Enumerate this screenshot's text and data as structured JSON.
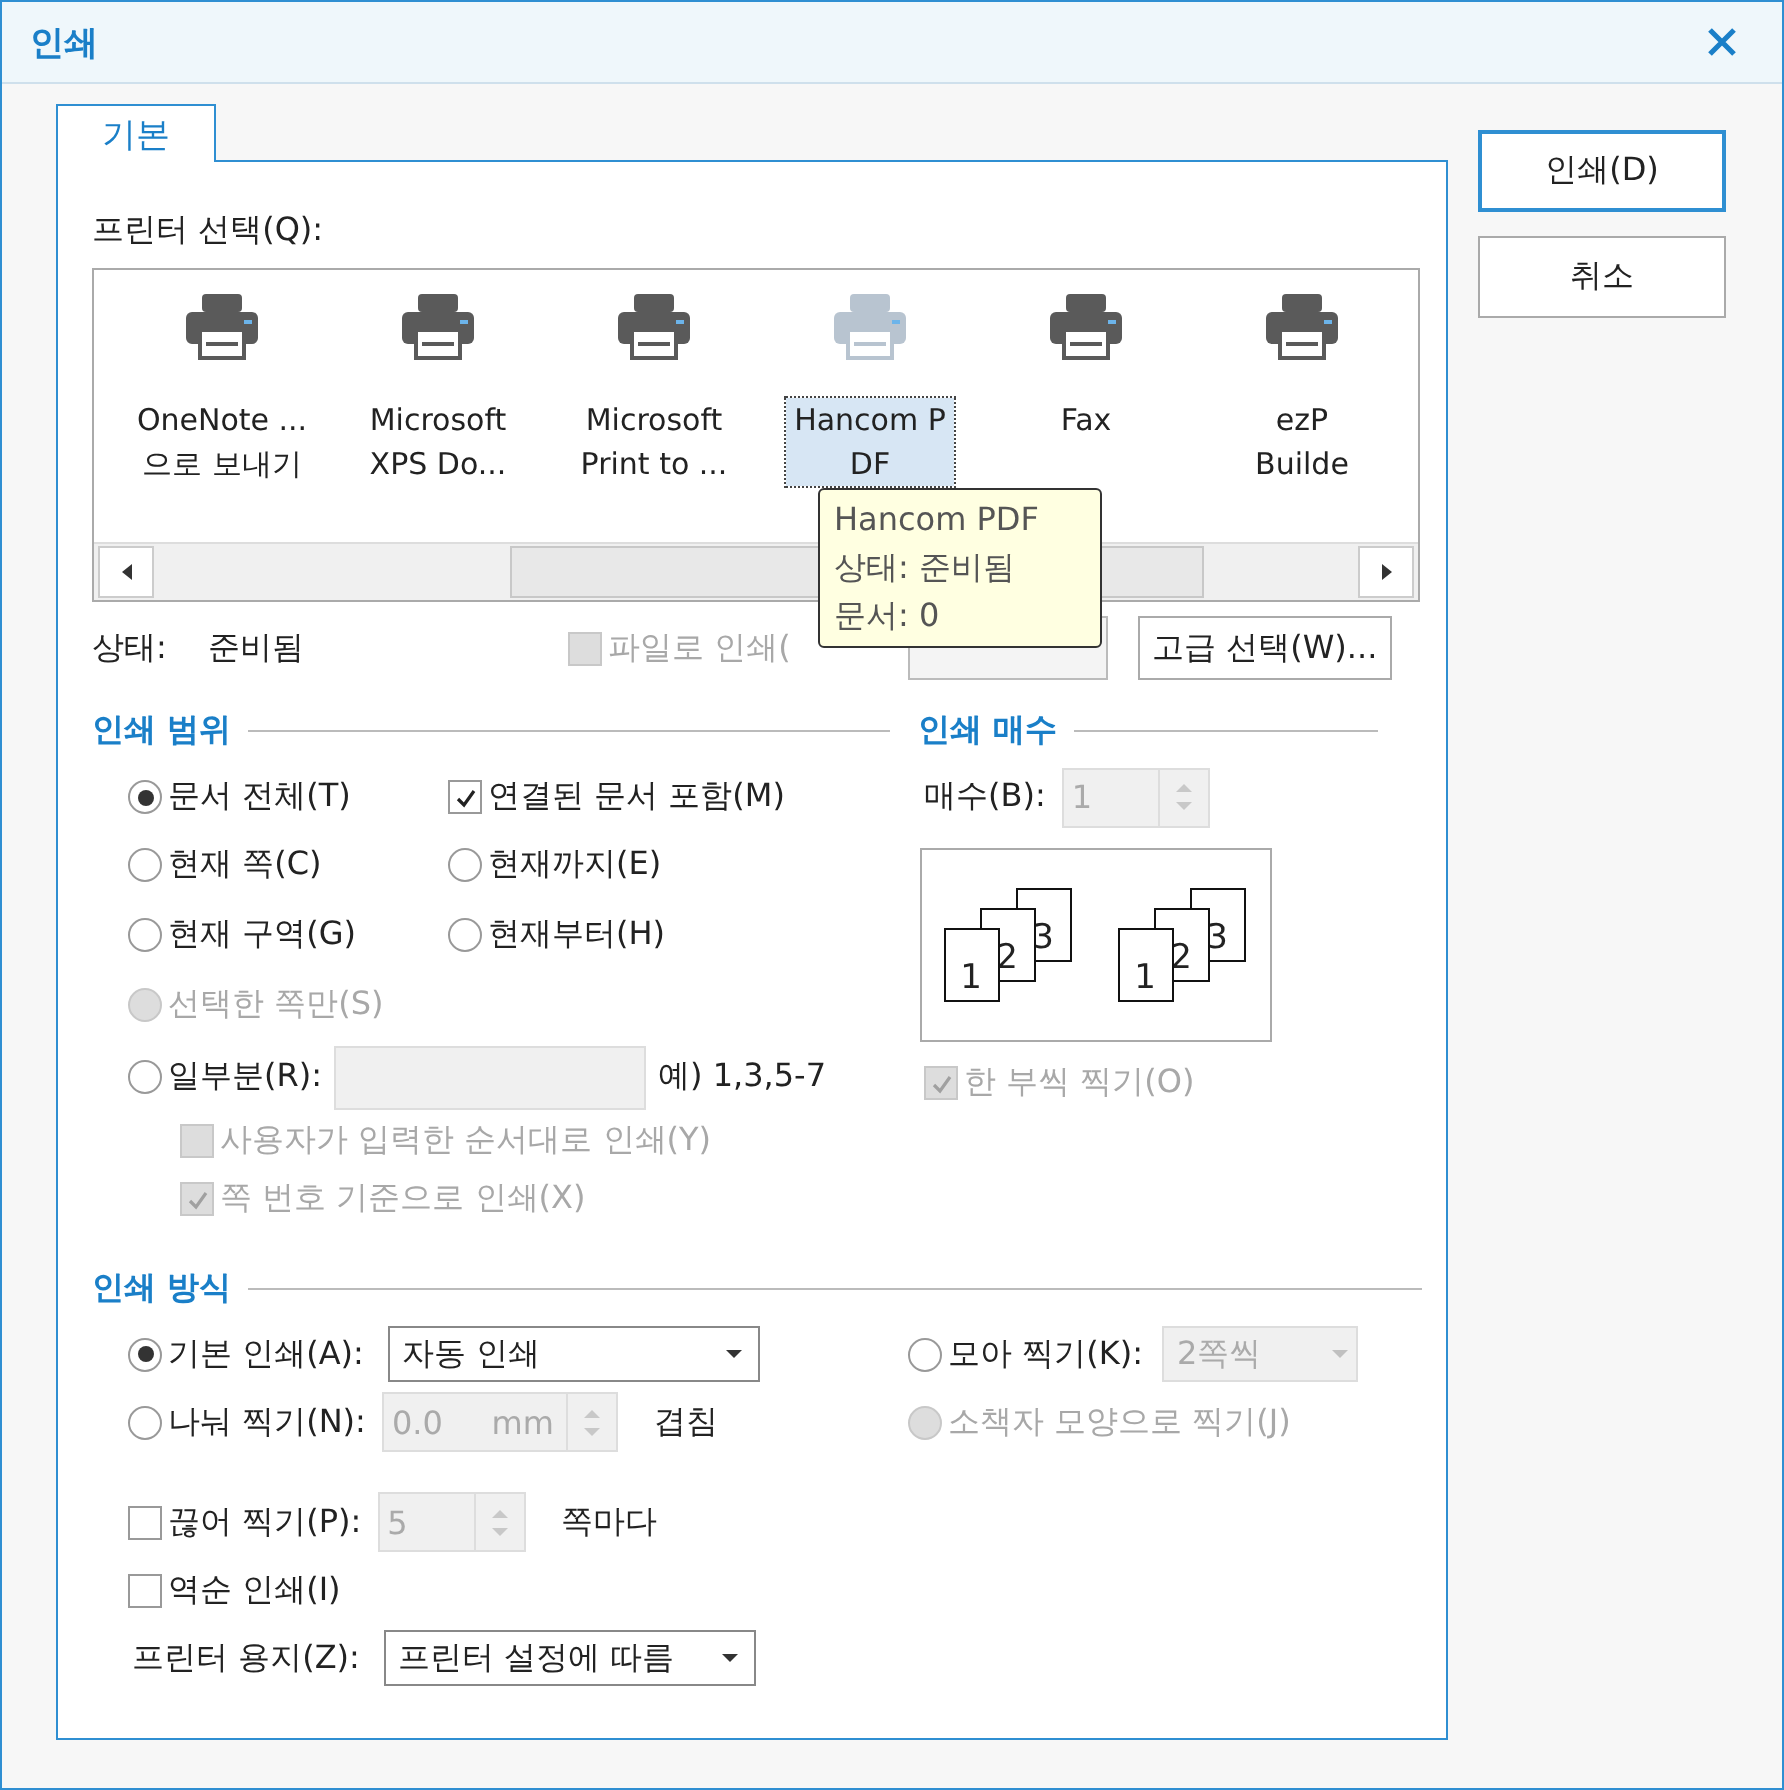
{
  "window": {
    "title": "인쇄"
  },
  "tabs": [
    {
      "label": "기본",
      "selected": true
    }
  ],
  "buttons": [
    {
      "label": "인쇄(D)",
      "default": true
    },
    {
      "label": "취소",
      "default": false
    }
  ],
  "printer_select": {
    "label": "프린터 선택(Q):",
    "printers": [
      {
        "lines": [
          "OneNote ...",
          "으로 보내기"
        ],
        "selected": false
      },
      {
        "lines": [
          "Microsoft",
          "XPS Do..."
        ],
        "selected": false
      },
      {
        "lines": [
          "Microsoft",
          "Print to ..."
        ],
        "selected": false
      },
      {
        "lines": [
          "Hancom P",
          "DF"
        ],
        "selected": true
      },
      {
        "lines": [
          "Fax"
        ],
        "selected": false
      },
      {
        "lines": [
          "ezP",
          "Builde"
        ],
        "selected": false
      }
    ],
    "tooltip": [
      "Hancom PDF",
      "상태: 준비됨",
      "문서: 0"
    ],
    "status_label": "상태:",
    "status_value": "준비됨",
    "print_to_file": {
      "label": "파일로 인쇄(",
      "checked": false,
      "disabled": true
    },
    "advanced_button": "고급 선택(W)..."
  },
  "range": {
    "title": "인쇄 범위",
    "rows": [
      [
        {
          "kind": "radio",
          "label": "문서 전체(T)",
          "selected": true,
          "disabled": false
        },
        {
          "kind": "checkbox",
          "label": "연결된 문서 포함(M)",
          "checked": true,
          "disabled": false
        }
      ],
      [
        {
          "kind": "radio",
          "label": "현재 쪽(C)",
          "selected": false,
          "disabled": false
        },
        {
          "kind": "radio",
          "label": "현재까지(E)",
          "selected": false,
          "disabled": false
        }
      ],
      [
        {
          "kind": "radio",
          "label": "현재 구역(G)",
          "selected": false,
          "disabled": false
        },
        {
          "kind": "radio",
          "label": "현재부터(H)",
          "selected": false,
          "disabled": false
        }
      ],
      [
        {
          "kind": "radio",
          "label": "선택한 쪽만(S)",
          "selected": false,
          "disabled": true
        }
      ]
    ],
    "partial": {
      "kind": "radio",
      "label": "일부분(R):",
      "selected": false,
      "disabled": false,
      "hint": "예) 1,3,5-7"
    },
    "sub_options": [
      {
        "kind": "checkbox",
        "label": "사용자가 입력한 순서대로 인쇄(Y)",
        "checked": false,
        "disabled": true
      },
      {
        "kind": "checkbox",
        "label": "쪽 번호 기준으로 인쇄(X)",
        "checked": true,
        "disabled": true
      }
    ]
  },
  "copies": {
    "title": "인쇄 매수",
    "label": "매수(B):",
    "value": "1",
    "collate_sets": [
      [
        "1",
        "2",
        "3"
      ],
      [
        "1",
        "2",
        "3"
      ]
    ],
    "collate": {
      "kind": "checkbox",
      "label": "한 부씩 찍기(O)",
      "checked": true,
      "disabled": true
    }
  },
  "method": {
    "title": "인쇄 방식",
    "basic": {
      "kind": "radio",
      "label": "기본 인쇄(A):",
      "selected": true,
      "disabled": false,
      "value": "자동 인쇄"
    },
    "nup": {
      "kind": "radio",
      "label": "모아 찍기(K):",
      "selected": false,
      "disabled": false,
      "value": "2쪽씩"
    },
    "tile": {
      "kind": "radio",
      "label": "나눠 찍기(N):",
      "selected": false,
      "disabled": false,
      "value": "0.0",
      "unit": "mm",
      "suffix": "겹침"
    },
    "booklet": {
      "kind": "radio",
      "label": "소책자 모양으로 찍기(J)",
      "selected": false,
      "disabled": true
    },
    "split": {
      "kind": "checkbox",
      "label": "끊어 찍기(P):",
      "checked": false,
      "disabled": false,
      "value": "5",
      "suffix": "쪽마다"
    },
    "reverse": {
      "kind": "checkbox",
      "label": "역순 인쇄(I)",
      "checked": false,
      "disabled": false
    },
    "paper": {
      "label": "프린터 용지(Z):",
      "value": "프린터 설정에 따름"
    }
  }
}
